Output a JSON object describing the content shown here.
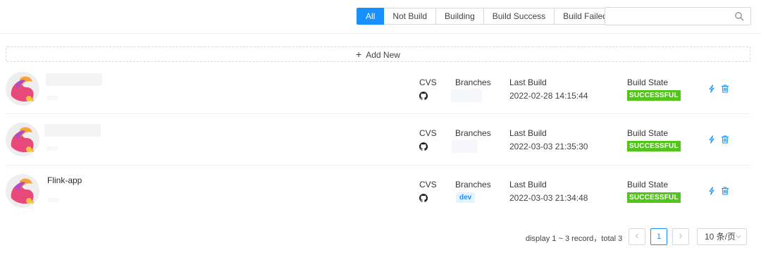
{
  "filters": {
    "options": [
      "All",
      "Not Build",
      "Building",
      "Build Success",
      "Build Failed"
    ],
    "active": "All",
    "accent_color": "#1890ff"
  },
  "search": {
    "placeholder": "",
    "value": "",
    "icon": "search-icon"
  },
  "add_new": {
    "label": "Add New",
    "icon": "plus-icon"
  },
  "columns": {
    "cvs": "CVS",
    "branches": "Branches",
    "last_build": "Last Build",
    "build_state": "Build State"
  },
  "projects": [
    {
      "title": "",
      "cvs_icon": "github-icon",
      "branch": "",
      "last_build": "2022-02-28 14:15:44",
      "build_state": "SUCCESSFUL"
    },
    {
      "title": "",
      "cvs_icon": "github-icon",
      "branch": "",
      "last_build": "2022-03-03 21:35:30",
      "build_state": "SUCCESSFUL"
    },
    {
      "title": "Flink-app",
      "cvs_icon": "github-icon",
      "branch": "dev",
      "last_build": "2022-03-03 21:34:48",
      "build_state": "SUCCESSFUL"
    }
  ],
  "row_actions": [
    "build-icon",
    "delete-icon"
  ],
  "status_color_success": "#52c41a",
  "pagination": {
    "summary": "display 1 ~ 3 record，total 3",
    "current_page": "1",
    "page_size": "10 条/页"
  }
}
